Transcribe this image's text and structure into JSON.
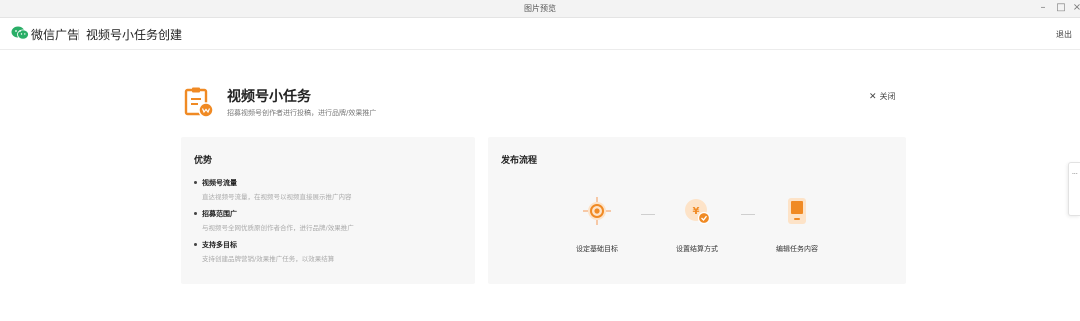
{
  "window": {
    "title": "图片预览",
    "controls": [
      "–",
      "□",
      "×"
    ]
  },
  "header": {
    "logo_icon": "wechat-icon",
    "brand": "微信广告",
    "page_title": "视频号小任务创建",
    "logout": "退出"
  },
  "task": {
    "icon": "task-clipboard-icon",
    "title": "视频号小任务",
    "subtitle": "招募视频号创作者进行投稿，进行品牌/效果推广",
    "close_label": "关闭"
  },
  "advantages": {
    "title": "优势",
    "items": [
      {
        "title": "视频号流量",
        "desc": "直达视频号流量，在视频号以视频直接展示推广内容"
      },
      {
        "title": "招募范围广",
        "desc": "与视频号全网优质原创作者合作，进行品牌/效果推广"
      },
      {
        "title": "支持多目标",
        "desc": "支持创建品牌营销/效果推广任务，以效果结算"
      }
    ]
  },
  "process": {
    "title": "发布流程",
    "steps": [
      {
        "label": "设定基础目标",
        "icon": "target-icon"
      },
      {
        "label": "设置结算方式",
        "icon": "yen-coin-icon"
      },
      {
        "label": "编辑任务内容",
        "icon": "phone-icon"
      }
    ]
  },
  "side_tab": {
    "text": "..."
  },
  "colors": {
    "accent": "#f08a24",
    "accent_light": "#fde3c8",
    "panel_bg": "#f7f7f7",
    "wechat_green": "#2aae67"
  }
}
